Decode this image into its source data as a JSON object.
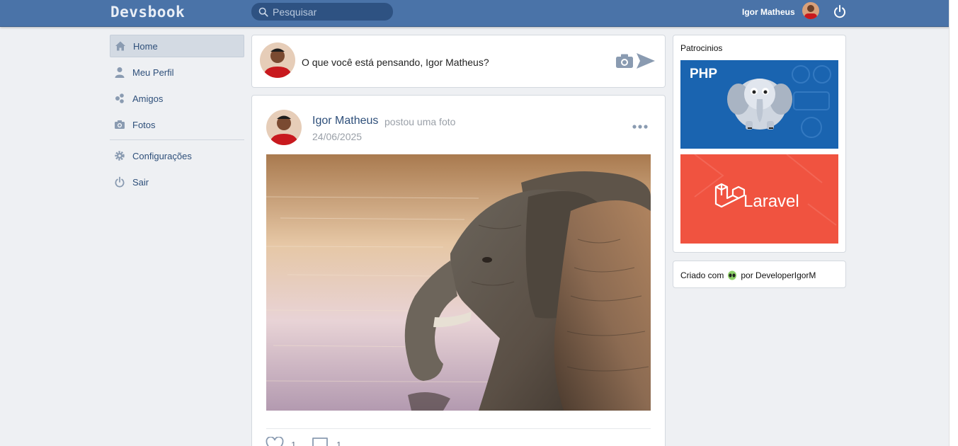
{
  "header": {
    "logo": "Devsbook",
    "search_placeholder": "Pesquisar",
    "user_name": "Igor Matheus"
  },
  "sidebar": {
    "items": [
      {
        "label": "Home",
        "icon": "home-icon",
        "active": true
      },
      {
        "label": "Meu Perfil",
        "icon": "user-icon"
      },
      {
        "label": "Amigos",
        "icon": "friends-icon"
      },
      {
        "label": "Fotos",
        "icon": "camera-icon"
      },
      {
        "label": "Configurações",
        "icon": "gear-icon"
      },
      {
        "label": "Sair",
        "icon": "power-icon"
      }
    ]
  },
  "composer": {
    "prompt": "O que você está pensando, Igor Matheus?"
  },
  "post": {
    "author": "Igor Matheus",
    "action": "postou uma foto",
    "date": "24/06/2025",
    "likes": "1",
    "comments": "1"
  },
  "sponsors": {
    "title": "Patrocinios",
    "ads": [
      {
        "label": "PHP",
        "color": "#1a64b0"
      },
      {
        "label": "Laravel",
        "color": "#f05340"
      }
    ]
  },
  "credit": {
    "prefix": "Criado com",
    "suffix": "por DeveloperIgorM"
  },
  "colors": {
    "header": "#4a73a8",
    "link": "#2e4f7a",
    "background": "#eef0f3"
  }
}
